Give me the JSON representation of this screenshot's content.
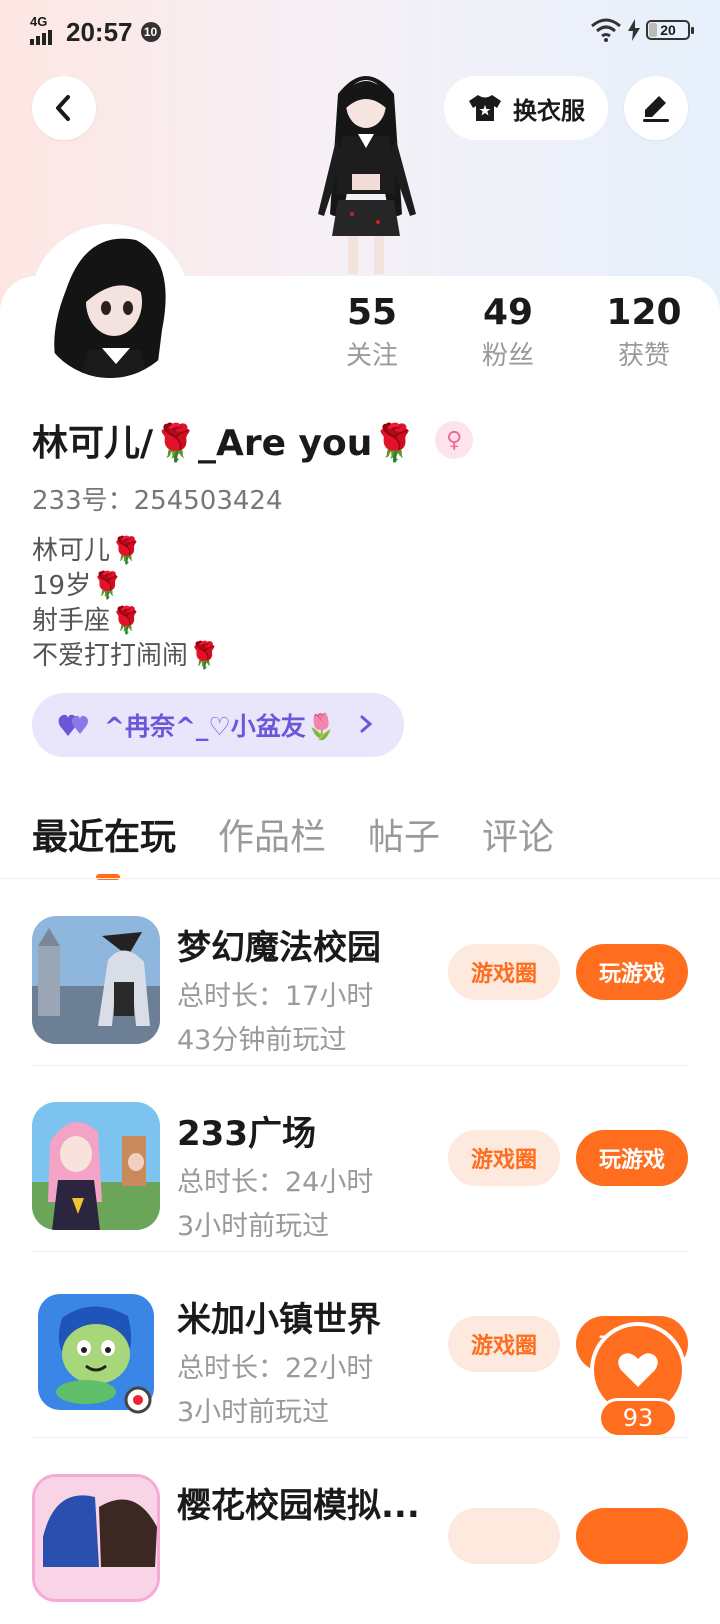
{
  "status_bar": {
    "network": "4G",
    "time": "20:57",
    "notification_badge": "10",
    "battery": "20"
  },
  "header": {
    "dress_up_label": "换衣服"
  },
  "stats": [
    {
      "value": "55",
      "label": "关注"
    },
    {
      "value": "49",
      "label": "粉丝"
    },
    {
      "value": "120",
      "label": "获赞"
    }
  ],
  "profile": {
    "name": "林可儿/🌹_Are you🌹",
    "gender_symbol": "♀",
    "id_label": "233号：254503424",
    "bio": [
      "林可儿🌹",
      "19岁🌹",
      "射手座🌹",
      "不爱打打闹闹🌹"
    ],
    "relation": "^冉奈^_♡小盆友🌷"
  },
  "tabs": [
    "最近在玩",
    "作品栏",
    "帖子",
    "评论"
  ],
  "games": [
    {
      "title": "梦幻魔法校园",
      "duration": "总时长：17小时",
      "last_played": "43分钟前玩过",
      "circle_label": "游戏圈",
      "play_label": "玩游戏"
    },
    {
      "title": "233广场",
      "duration": "总时长：24小时",
      "last_played": "3小时前玩过",
      "circle_label": "游戏圈",
      "play_label": "玩游戏"
    },
    {
      "title": "米加小镇世界",
      "duration": "总时长：22小时",
      "last_played": "3小时前玩过",
      "circle_label": "游戏圈",
      "play_label": "玩游戏"
    },
    {
      "title": "樱花校园模拟...",
      "duration": "",
      "last_played": "",
      "circle_label": "",
      "play_label": ""
    }
  ],
  "like_float": {
    "count": "93"
  },
  "colors": {
    "accent": "#ff6d1f",
    "relation_text": "#6b57d9",
    "relation_bg": "#e9e5fb"
  }
}
